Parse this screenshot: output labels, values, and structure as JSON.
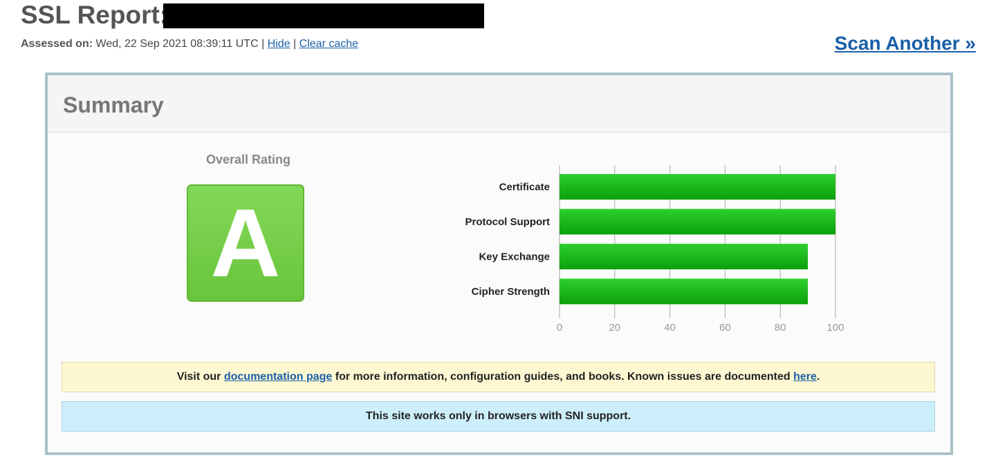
{
  "header": {
    "title": "SSL Report:",
    "assessed_label": "Assessed on:",
    "assessed_value": "Wed, 22 Sep 2021 08:39:11 UTC",
    "separator": "|",
    "hide_link": "Hide",
    "clear_cache_link": "Clear cache",
    "scan_another": "Scan Another »"
  },
  "summary": {
    "title": "Summary",
    "overall_rating_label": "Overall Rating",
    "grade": "A",
    "grade_color": "#72cb45"
  },
  "chart_data": {
    "type": "bar",
    "orientation": "horizontal",
    "categories": [
      "Certificate",
      "Protocol Support",
      "Key Exchange",
      "Cipher Strength"
    ],
    "values": [
      100,
      100,
      90,
      90
    ],
    "xlim": [
      0,
      100
    ],
    "xticks": [
      0,
      20,
      40,
      60,
      80,
      100
    ],
    "grid": true,
    "bar_color": "#1cb81c"
  },
  "notices": {
    "doc_prefix": "Visit our",
    "doc_link": "documentation page",
    "doc_middle": "for more information, configuration guides, and books. Known issues are documented",
    "doc_here_link": "here",
    "doc_suffix": ".",
    "sni": "This site works only in browsers with SNI support."
  },
  "colors": {
    "link": "#1a5fa8",
    "box_border": "#a9c1c9",
    "doc_notice_bg": "#fdf8d2",
    "sni_notice_bg": "#cdeefb"
  }
}
